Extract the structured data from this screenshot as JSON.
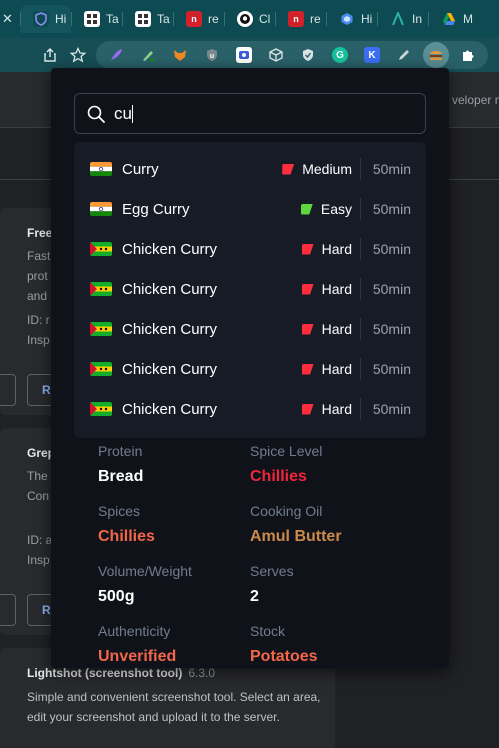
{
  "tabs": [
    {
      "label": "",
      "favicon": "close-tab-glyph",
      "color": "#0d4a52"
    },
    {
      "label": "Hi",
      "favicon": "shield-icon",
      "color": "#5b5fe8"
    },
    {
      "label": "Ta",
      "favicon": "grid-icon",
      "color": "#ffffff"
    },
    {
      "label": "Ta",
      "favicon": "grid-icon",
      "color": "#ffffff"
    },
    {
      "label": "re",
      "favicon": "n-logo-icon",
      "color": "#d1212b"
    },
    {
      "label": "Cl",
      "favicon": "github-icon",
      "color": "#ffffff"
    },
    {
      "label": "re",
      "favicon": "n-logo-icon",
      "color": "#d1212b"
    },
    {
      "label": "Hi",
      "favicon": "hex-icon",
      "color": "#4a8df0"
    },
    {
      "label": "In",
      "favicon": "a-logo-icon",
      "color": "#2bb3a3"
    },
    {
      "label": "M",
      "favicon": "drive-icon",
      "color": "#f4b400"
    }
  ],
  "toolbar": {
    "share_icon": "share-icon",
    "bookmark_icon": "star-icon",
    "extensions": [
      "feather-icon",
      "pen-icon",
      "fox-icon",
      "ublock-icon",
      "screen-icon",
      "cube-icon",
      "shield-check-icon",
      "grammarly-icon",
      "k-icon",
      "pencil-icon",
      "burger-icon",
      "puzzle-icon"
    ]
  },
  "background": {
    "right_text": "veloper m",
    "card1": {
      "title": "Free",
      "lines": [
        "Fast",
        "prot",
        "and",
        "ID: r",
        "Insp"
      ],
      "button": "R"
    },
    "card2": {
      "title": "Grep",
      "lines": [
        "The",
        "Con",
        "ID: a",
        "Insp"
      ],
      "button": "R"
    },
    "lightshot": {
      "title": "Lightshot (screenshot tool)",
      "version": "6.3.0",
      "description": "Simple and convenient screenshot tool. Select an area, edit your screenshot and upload it to the server."
    }
  },
  "popup": {
    "search": {
      "value": "cu"
    },
    "results": [
      {
        "name": "Curry",
        "flag": "india",
        "difficulty": "Medium",
        "difficulty_color": "#ff2d3d",
        "time": "50min"
      },
      {
        "name": "Egg Curry",
        "flag": "india",
        "difficulty": "Easy",
        "difficulty_color": "#5ed63c",
        "time": "50min"
      },
      {
        "name": "Chicken Curry",
        "flag": "sao-tome",
        "difficulty": "Hard",
        "difficulty_color": "#ff2d3d",
        "time": "50min"
      },
      {
        "name": "Chicken Curry",
        "flag": "sao-tome",
        "difficulty": "Hard",
        "difficulty_color": "#ff2d3d",
        "time": "50min"
      },
      {
        "name": "Chicken Curry",
        "flag": "sao-tome",
        "difficulty": "Hard",
        "difficulty_color": "#ff2d3d",
        "time": "50min"
      },
      {
        "name": "Chicken Curry",
        "flag": "sao-tome",
        "difficulty": "Hard",
        "difficulty_color": "#ff2d3d",
        "time": "50min"
      },
      {
        "name": "Chicken Curry",
        "flag": "sao-tome",
        "difficulty": "Hard",
        "difficulty_color": "#ff2d3d",
        "time": "50min"
      }
    ],
    "details": [
      {
        "label": "Protein",
        "value": "Bread",
        "color": "#ffffff"
      },
      {
        "label": "Spice Level",
        "value": "Chillies",
        "color": "#f0243c"
      },
      {
        "label": "Spices",
        "value": "Chillies",
        "color": "#f2664a"
      },
      {
        "label": "Cooking Oil",
        "value": "Amul Butter",
        "color": "#c98a4a"
      },
      {
        "label": "Volume/Weight",
        "value": "500g",
        "color": "#ffffff"
      },
      {
        "label": "Serves",
        "value": "2",
        "color": "#ffffff"
      },
      {
        "label": "Authenticity",
        "value": "Unverified",
        "color": "#f2664a"
      },
      {
        "label": "Stock",
        "value": "Potatoes",
        "color": "#f2664a"
      }
    ]
  }
}
